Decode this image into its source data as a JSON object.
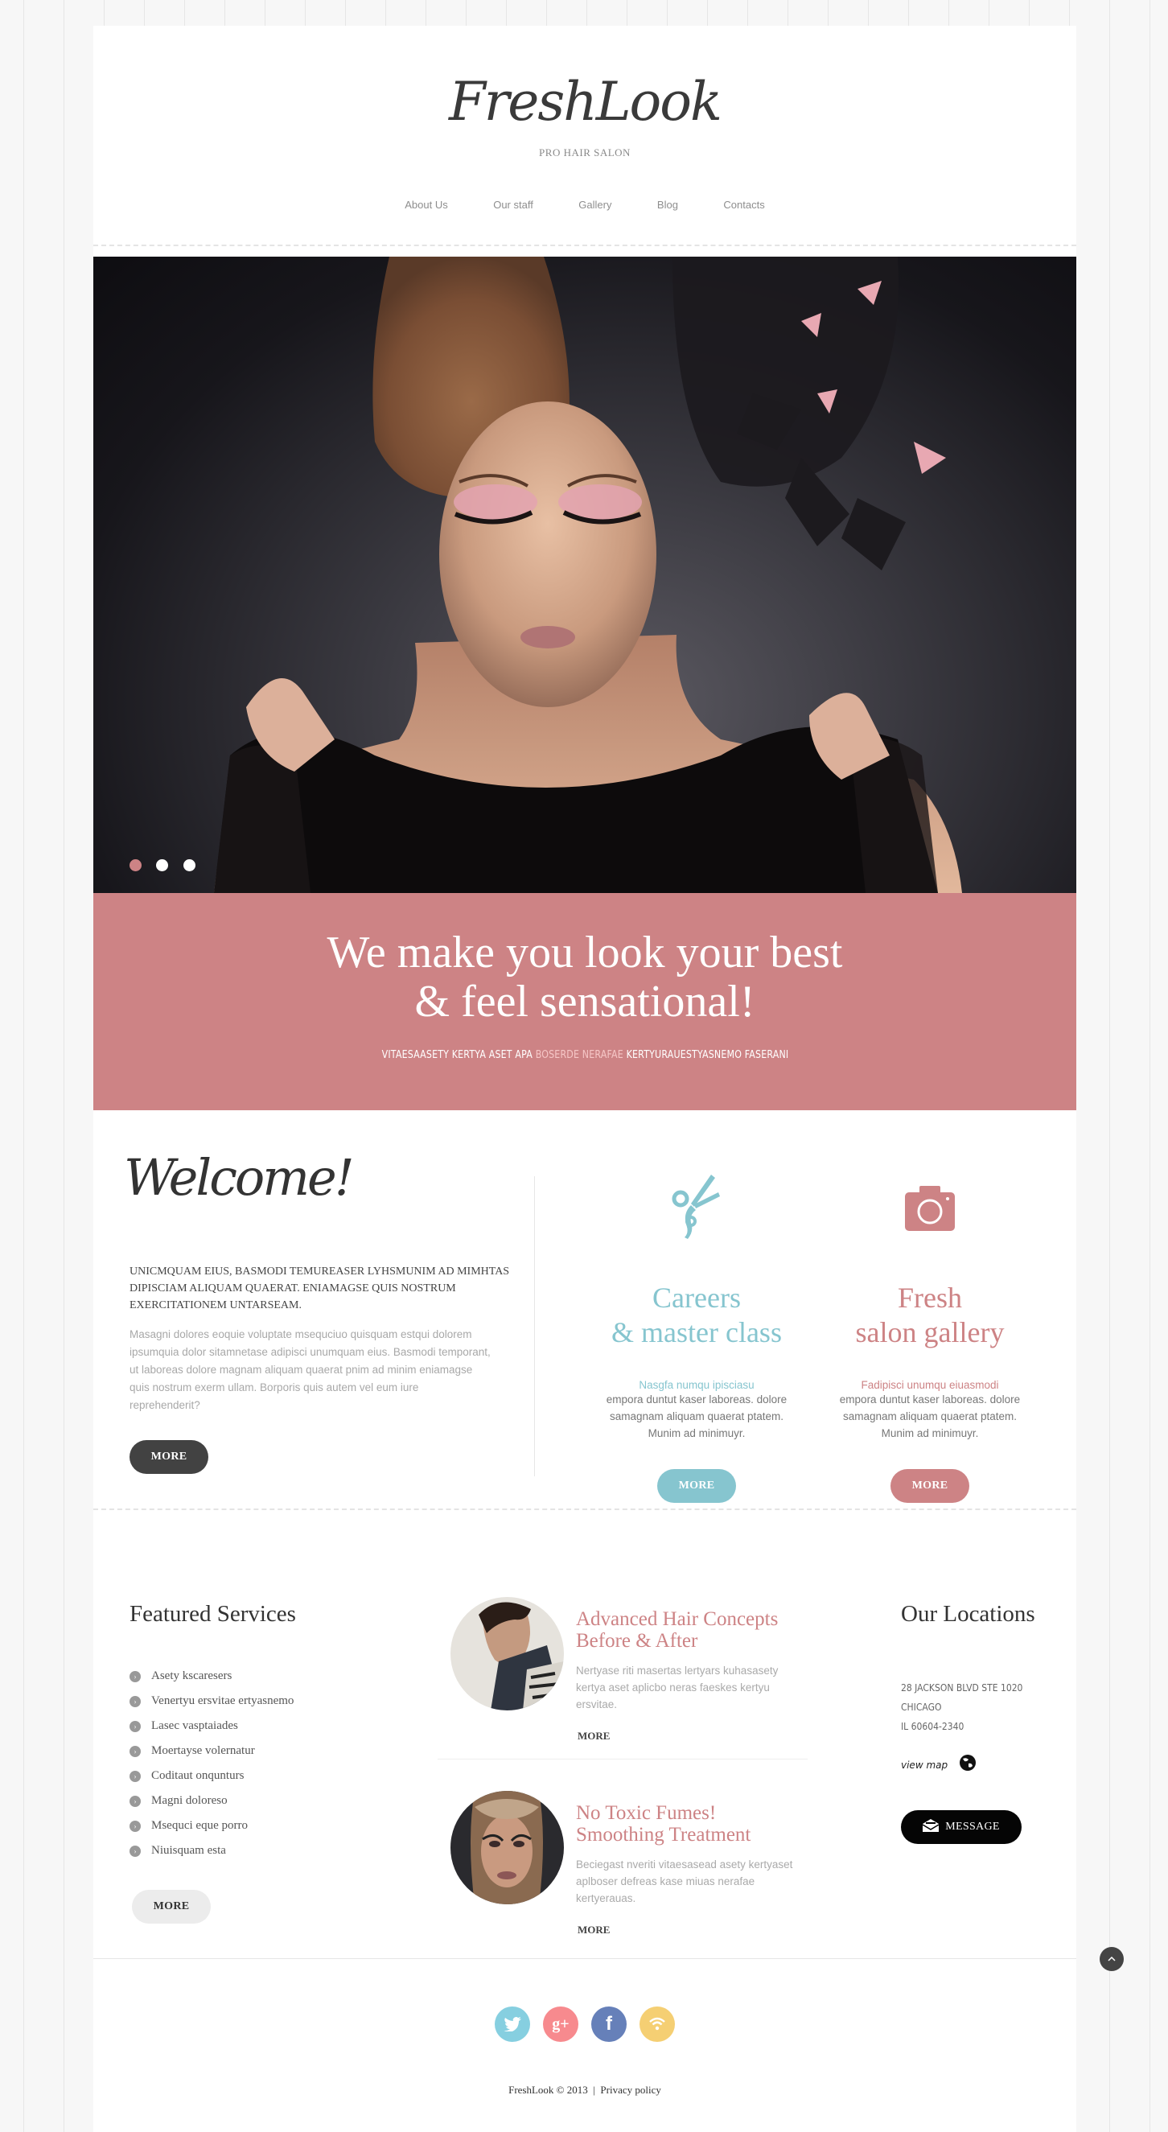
{
  "header": {
    "logo": "FreshLook",
    "tagline": "PRO HAIR SALON",
    "nav": [
      "About Us",
      "Our staff",
      "Gallery",
      "Blog",
      "Contacts"
    ]
  },
  "slider": {
    "slide_count": 3,
    "active_slide": 1,
    "image_alt": "Woman with styled updo hair and butterfly headpiece"
  },
  "banner": {
    "headline_line1": "We make you look your best",
    "headline_line2": "& feel sensational!",
    "sub_before": "VITAESAASETY KERTYA ASET APA ",
    "sub_highlight": "BOSERDE NERAFAE",
    "sub_after": " KERTYURAUESTYASNEMO FASERANI"
  },
  "welcome": {
    "title": "Welcome!",
    "lead": "UNICMQUAM EIUS, BASMODI TEMUREASER  LYHSMUNIM AD MIMHTAS DIPISCIAM ALIQUAM QUAERAT. ENIAMAGSE QUIS NOSTRUM EXERCITATIONEM UNTARSEAM.",
    "body": "Masagni dolores eoquie voluptate msequciuo quisquam estqui dolorem ipsumquia dolor sitamnetase adipisci unumquam eius. Basmodi temporant, ut laboreas dolore magnam aliquam quaerat pnim ad minim eniamagse quis nostrum exerm ullam. Borporis quis autem vel eum iure reprehenderit?",
    "more_label": "MORE"
  },
  "promos": [
    {
      "icon": "scissors-icon",
      "title_line1": "Careers",
      "title_line2": "& master class",
      "accent": "Nasgfa numqu ipisciasu",
      "text": "empora duntut kaser laboreas. dolore samagnam aliquam quaerat ptatem. Munim ad minimuyr.",
      "more_label": "MORE",
      "color": "#86c5cf"
    },
    {
      "icon": "camera-icon",
      "title_line1": "Fresh",
      "title_line2": "salon gallery",
      "accent": "Fadipisci unumqu eiuasmodi",
      "text": "empora duntut kaser laboreas. dolore samagnam aliquam quaerat ptatem. Munim ad minimuyr.",
      "more_label": "MORE",
      "color": "#cd8385"
    }
  ],
  "featured": {
    "title": "Featured Services",
    "items": [
      "Asety kscaresers",
      "Venertyu ersvitae ertyasnemo",
      "Lasec vasptaiades",
      "Moertayse volernatur",
      "Coditaut onqunturs",
      "Magni doloreso",
      "Msequci eque porro",
      "Niuisquam esta"
    ],
    "more_label": "MORE"
  },
  "articles": [
    {
      "title_line1": "Advanced Hair Concepts",
      "title_line2": "Before & After",
      "text": "Nertyase riti masertas lertyars kuhasasety kertya aset aplicbo neras faeskes kertyu ersvitae.",
      "more_label": "MORE"
    },
    {
      "title_line1": "No Toxic Fumes!",
      "title_line2": "Smoothing Treatment",
      "text": "Beciegast nveriti vitaesasead asety kertyaset aplboser defreas kase miuas nerafae kertyerauas.",
      "more_label": "MORE"
    }
  ],
  "locations": {
    "title": "Our Locations",
    "address_line1": "28 JACKSON BLVD STE 1020",
    "address_line2": "CHICAGO",
    "address_line3": "IL 60604-2340",
    "view_map": "view map",
    "message_label": "MESSAGE"
  },
  "footer": {
    "social": [
      "twitter",
      "google-plus",
      "facebook",
      "rss"
    ],
    "social_colors": [
      "#86cfe0",
      "#f78a8e",
      "#6680b9",
      "#f5cf73"
    ],
    "copyright": "FreshLook © 2013",
    "separator": "|",
    "privacy": "Privacy policy"
  },
  "colors": {
    "accent_pink": "#cd8385",
    "accent_blue": "#86c5cf",
    "dark": "#424242"
  }
}
